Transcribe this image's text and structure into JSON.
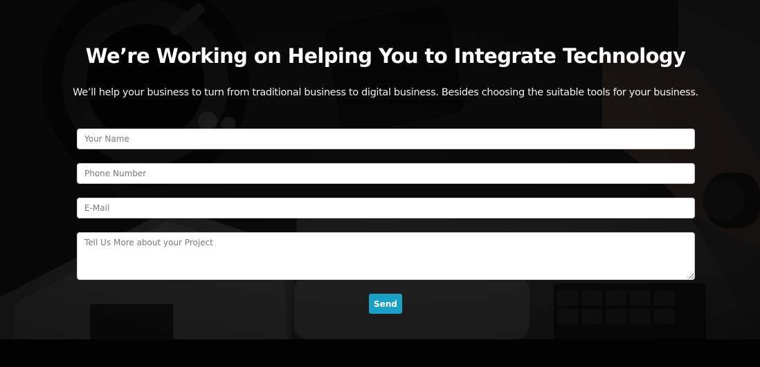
{
  "hero": {
    "title": "We’re Working on Helping You to Integrate Technology",
    "subtitle": "We’ll help your business to turn from traditional business to digital business. Besides choosing the suitable tools for your business."
  },
  "form": {
    "name_placeholder": "Your Name",
    "phone_placeholder": "Phone Number",
    "email_placeholder": "E-Mail",
    "message_placeholder": "Tell Us More about your Project",
    "send_label": "Send"
  },
  "colors": {
    "button": "#19a0c4",
    "overlay": "#000000"
  }
}
